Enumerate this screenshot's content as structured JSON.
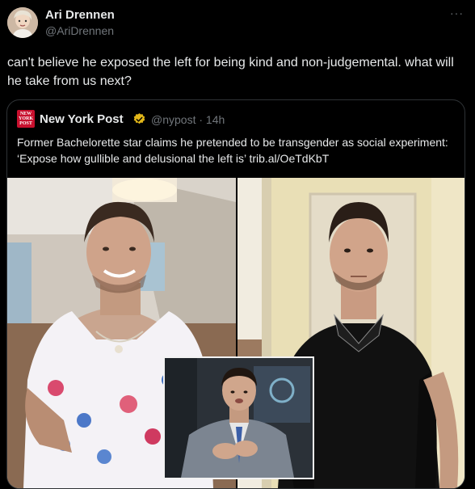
{
  "author": {
    "name": "Ari Drennen",
    "handle": "@AriDrennen",
    "avatar_icon": "profile-photo"
  },
  "more_label": "···",
  "tweet_text": "can't believe he exposed the left for being kind and non-judgemental. what will he take from us next?",
  "quoted_tweet": {
    "logo_icon": "new-york-post-logo",
    "logo_text": "NEW YORK POST",
    "author_name": "New York Post",
    "verified_icon": "gold-verified-badge",
    "handle_time": "@nypost · 14h",
    "text": "Former Bachelorette star claims he pretended to be transgender as social experiment: ‘Expose how gullible and delusional the left is’ trib.al/OeTdKbT",
    "images": [
      {
        "icon": "photo-man-floral-dress"
      },
      {
        "icon": "photo-man-black-polo"
      },
      {
        "icon": "inset-photo-man-in-suit-clapping"
      }
    ]
  },
  "colors": {
    "background": "#000000",
    "text": "#e7e9ea",
    "secondary_text": "#71767b",
    "border": "#2f3336",
    "nypost_red": "#c8102e",
    "verified_gold": "#e2b719"
  }
}
